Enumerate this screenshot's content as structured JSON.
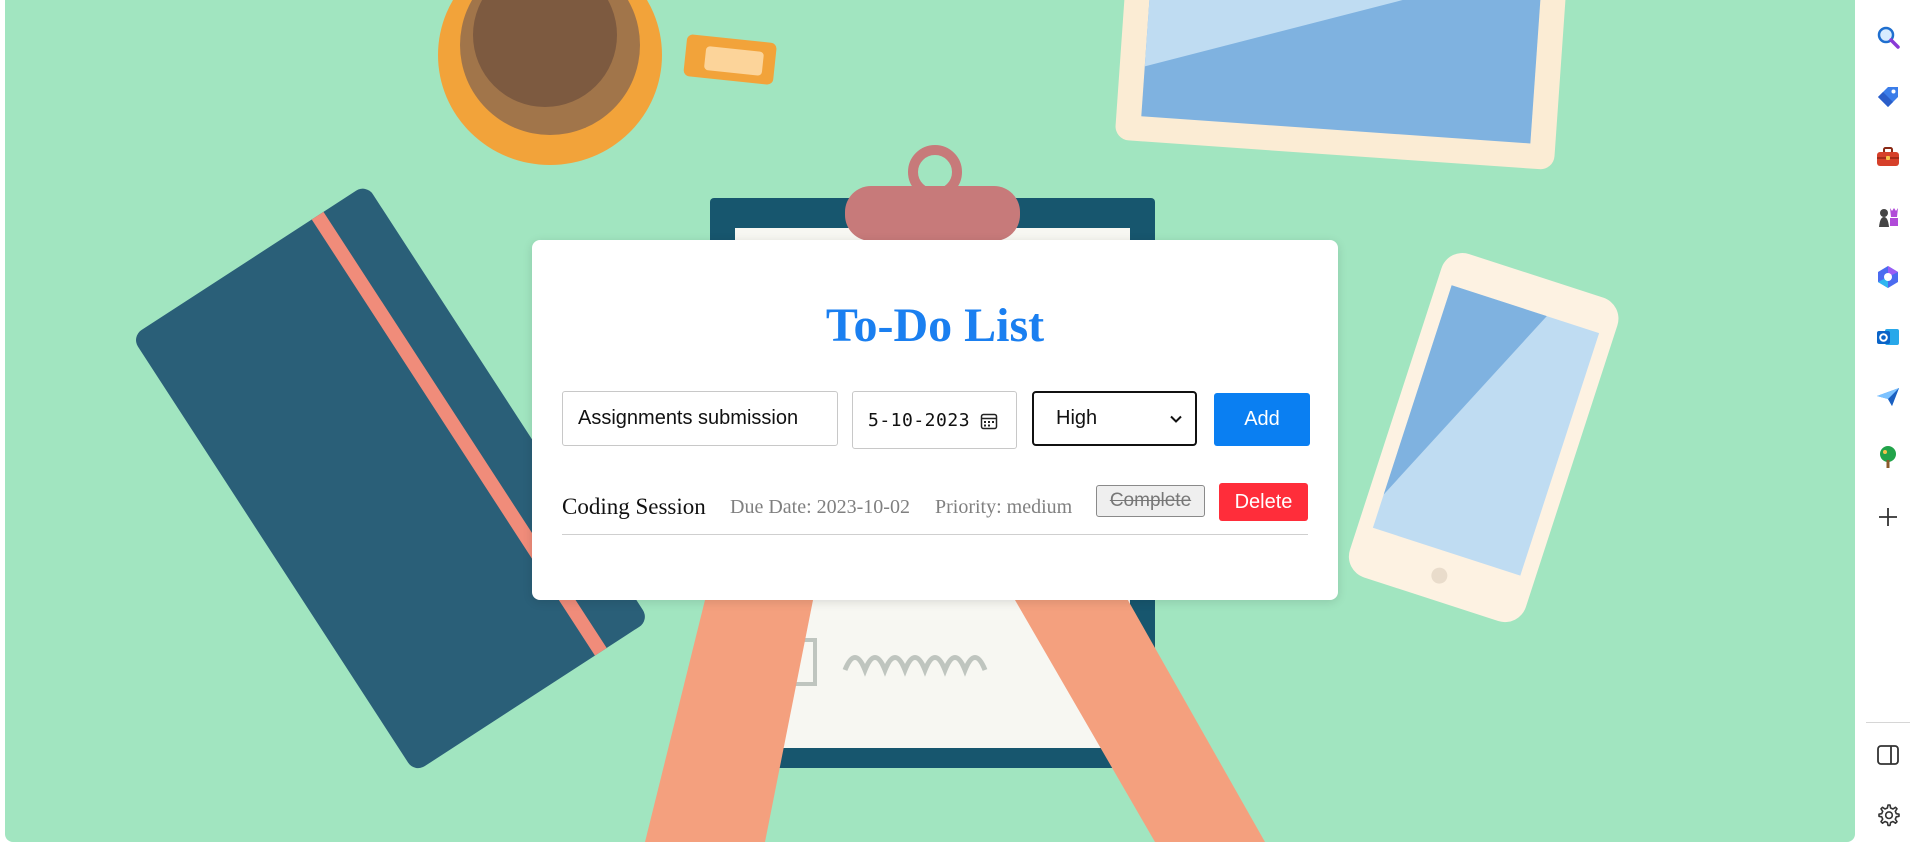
{
  "app": {
    "title": "To-Do List"
  },
  "form": {
    "task_value": "Assignments submission",
    "date_value": "5-10-2023",
    "priority_selected": "High",
    "add_label": "Add"
  },
  "tasks": [
    {
      "name": "Coding Session",
      "due": "Due Date: 2023-10-02",
      "priority": "Priority: medium",
      "complete_label": "Complete",
      "delete_label": "Delete"
    }
  ],
  "colors": {
    "title": "#1a7ff0",
    "add_button": "#0a7ff2",
    "delete_button": "#ff2d3a",
    "background": "#a1e5c0"
  },
  "sidebar": {
    "items": [
      {
        "icon": "search-icon"
      },
      {
        "icon": "tag-icon"
      },
      {
        "icon": "toolbox-icon"
      },
      {
        "icon": "chess-icon"
      },
      {
        "icon": "copilot-icon"
      },
      {
        "icon": "outlook-icon"
      },
      {
        "icon": "send-icon"
      },
      {
        "icon": "tree-icon"
      },
      {
        "icon": "add-icon"
      }
    ],
    "bottom": [
      {
        "icon": "panel-icon"
      },
      {
        "icon": "settings-icon"
      }
    ]
  }
}
